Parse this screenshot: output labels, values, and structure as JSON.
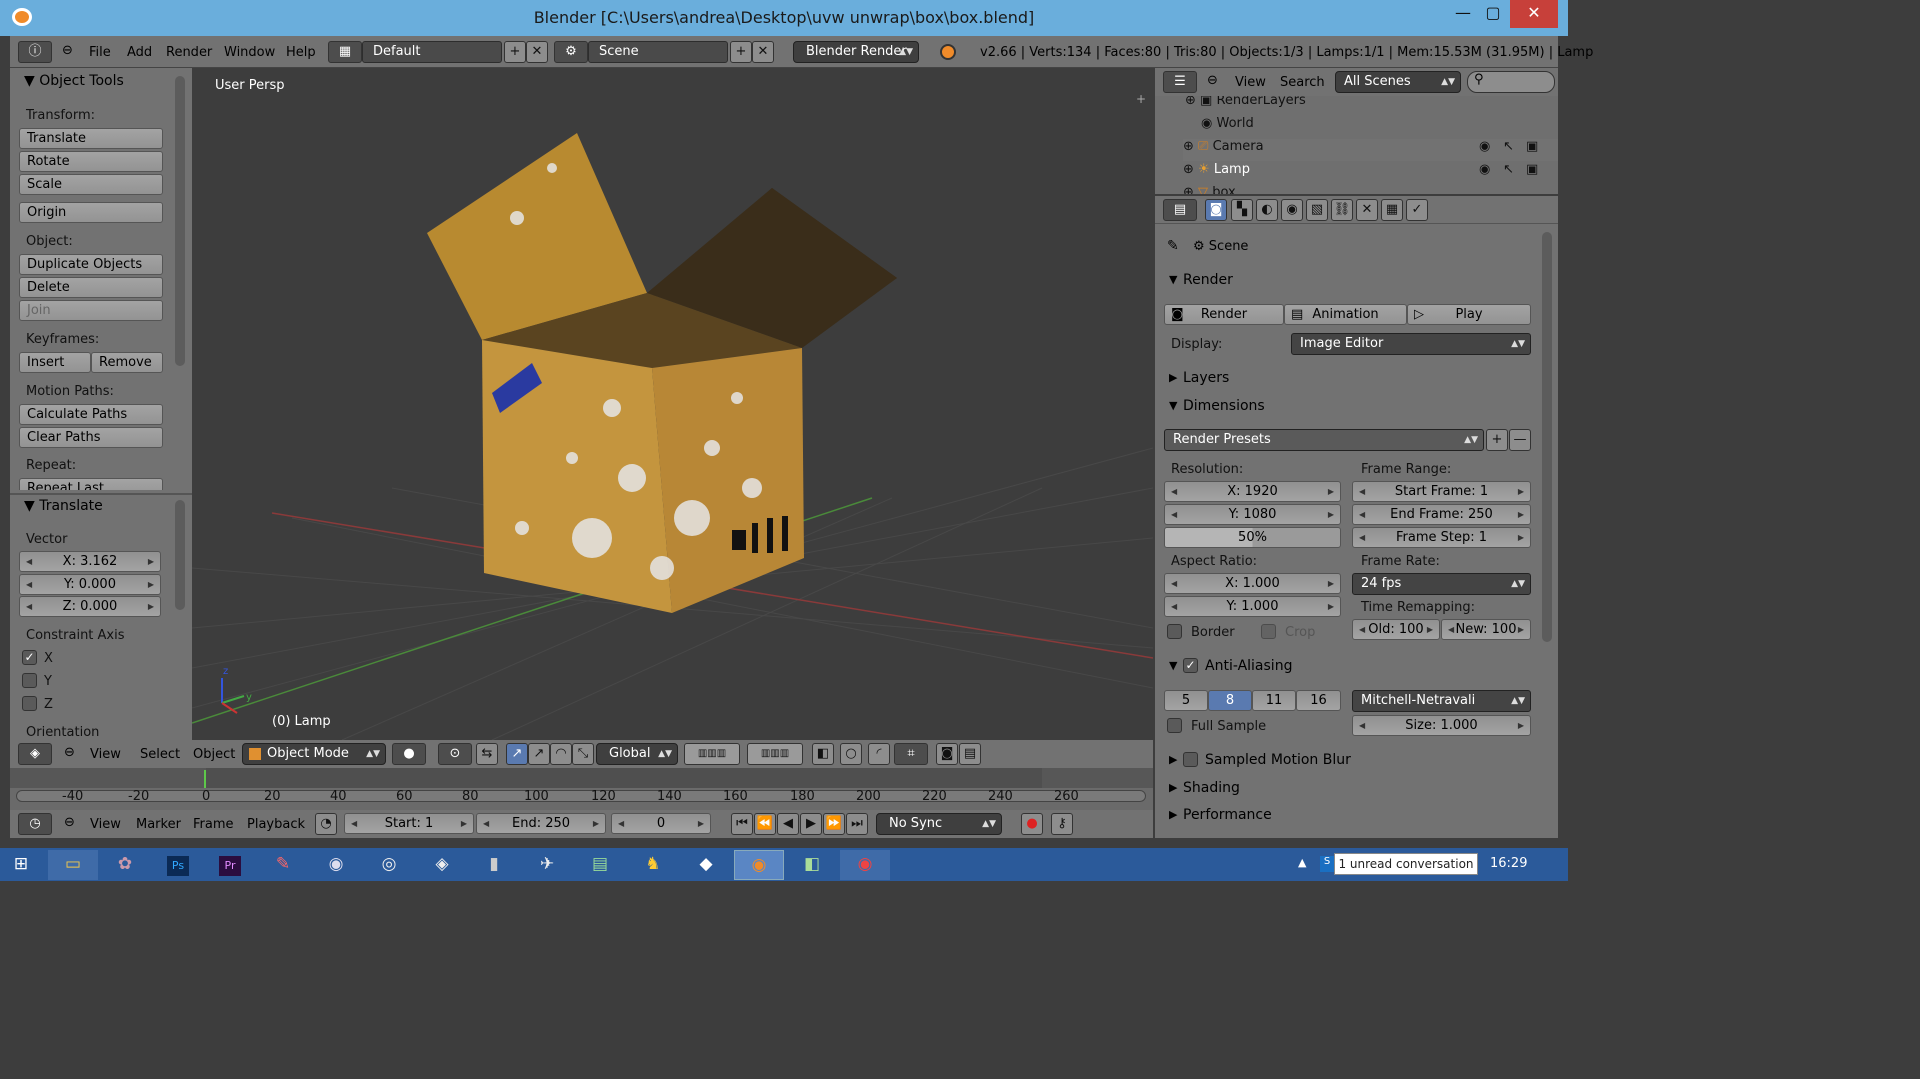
{
  "window": {
    "title": "Blender [C:\\Users\\andrea\\Desktop\\uvw unwrap\\box\\box.blend]",
    "minimize": "—",
    "maximize": "▢",
    "close": "✕"
  },
  "menubar": {
    "items": [
      "File",
      "Add",
      "Render",
      "Window",
      "Help"
    ],
    "layout": "Default",
    "scene": "Scene",
    "engine": "Blender Render",
    "stats": "v2.66 | Verts:134 | Faces:80 | Tris:80 | Objects:1/3 | Lamps:1/1 | Mem:15.53M (31.95M) | Lamp"
  },
  "tools": {
    "header": "Object Tools",
    "transform_label": "Transform:",
    "translate": "Translate",
    "rotate": "Rotate",
    "scale": "Scale",
    "origin": "Origin",
    "object_label": "Object:",
    "duplicate": "Duplicate Objects",
    "delete": "Delete",
    "join": "Join",
    "keyframes_label": "Keyframes:",
    "insert": "Insert",
    "remove": "Remove",
    "motion_label": "Motion Paths:",
    "calc_paths": "Calculate Paths",
    "clear_paths": "Clear Paths",
    "repeat_label": "Repeat:",
    "repeat_last": "Repeat Last"
  },
  "operator": {
    "header": "Translate",
    "vector_label": "Vector",
    "x": "X: 3.162",
    "y": "Y: 0.000",
    "z": "Z: 0.000",
    "constraint_label": "Constraint Axis",
    "cx": "X",
    "cy": "Y",
    "cz": "Z",
    "orientation_label": "Orientation"
  },
  "viewport": {
    "view_name": "User Persp",
    "object_info": "(0) Lamp",
    "axis_z": "z",
    "axis_y": "y"
  },
  "viewport_header": {
    "view": "View",
    "select": "Select",
    "object": "Object",
    "mode": "Object Mode",
    "orientation": "Global"
  },
  "timeline": {
    "ticks": [
      "-40",
      "-20",
      "0",
      "20",
      "40",
      "60",
      "80",
      "100",
      "120",
      "140",
      "160",
      "180",
      "200",
      "220",
      "240",
      "260"
    ]
  },
  "timeline_header": {
    "view": "View",
    "marker": "Marker",
    "frame": "Frame",
    "playback": "Playback",
    "start": "Start: 1",
    "end": "End: 250",
    "current": "0",
    "sync": "No Sync"
  },
  "outliner": {
    "view": "View",
    "search": "Search",
    "filter": "All Scenes",
    "items": [
      "RenderLayers",
      "World",
      "Camera",
      "Lamp",
      "box"
    ]
  },
  "properties": {
    "context": "Scene",
    "render_header": "Render",
    "render_btn": "Render",
    "animation_btn": "Animation",
    "play_btn": "Play",
    "display_label": "Display:",
    "display_value": "Image Editor",
    "layers_header": "Layers",
    "dimensions_header": "Dimensions",
    "presets": "Render Presets",
    "resolution_label": "Resolution:",
    "res_x": "X: 1920",
    "res_y": "Y: 1080",
    "res_pct": "50%",
    "frame_range_label": "Frame Range:",
    "start_frame": "Start Frame: 1",
    "end_frame": "End Frame: 250",
    "frame_step": "Frame Step: 1",
    "aspect_label": "Aspect Ratio:",
    "asp_x": "X: 1.000",
    "asp_y": "Y: 1.000",
    "frame_rate_label": "Frame Rate:",
    "frame_rate": "24 fps",
    "border": "Border",
    "crop": "Crop",
    "time_remap_label": "Time Remapping:",
    "old": "Old: 100",
    "new": "New: 100",
    "aa_header": "Anti-Aliasing",
    "aa_samples": [
      "5",
      "8",
      "11",
      "16"
    ],
    "aa_filter": "Mitchell-Netravali",
    "full_sample": "Full Sample",
    "size": "Size: 1.000",
    "motion_blur_header": "Sampled Motion Blur",
    "shading_header": "Shading",
    "performance_header": "Performance"
  },
  "taskbar": {
    "notification": "1 unread conversation",
    "clock": "16:29"
  }
}
